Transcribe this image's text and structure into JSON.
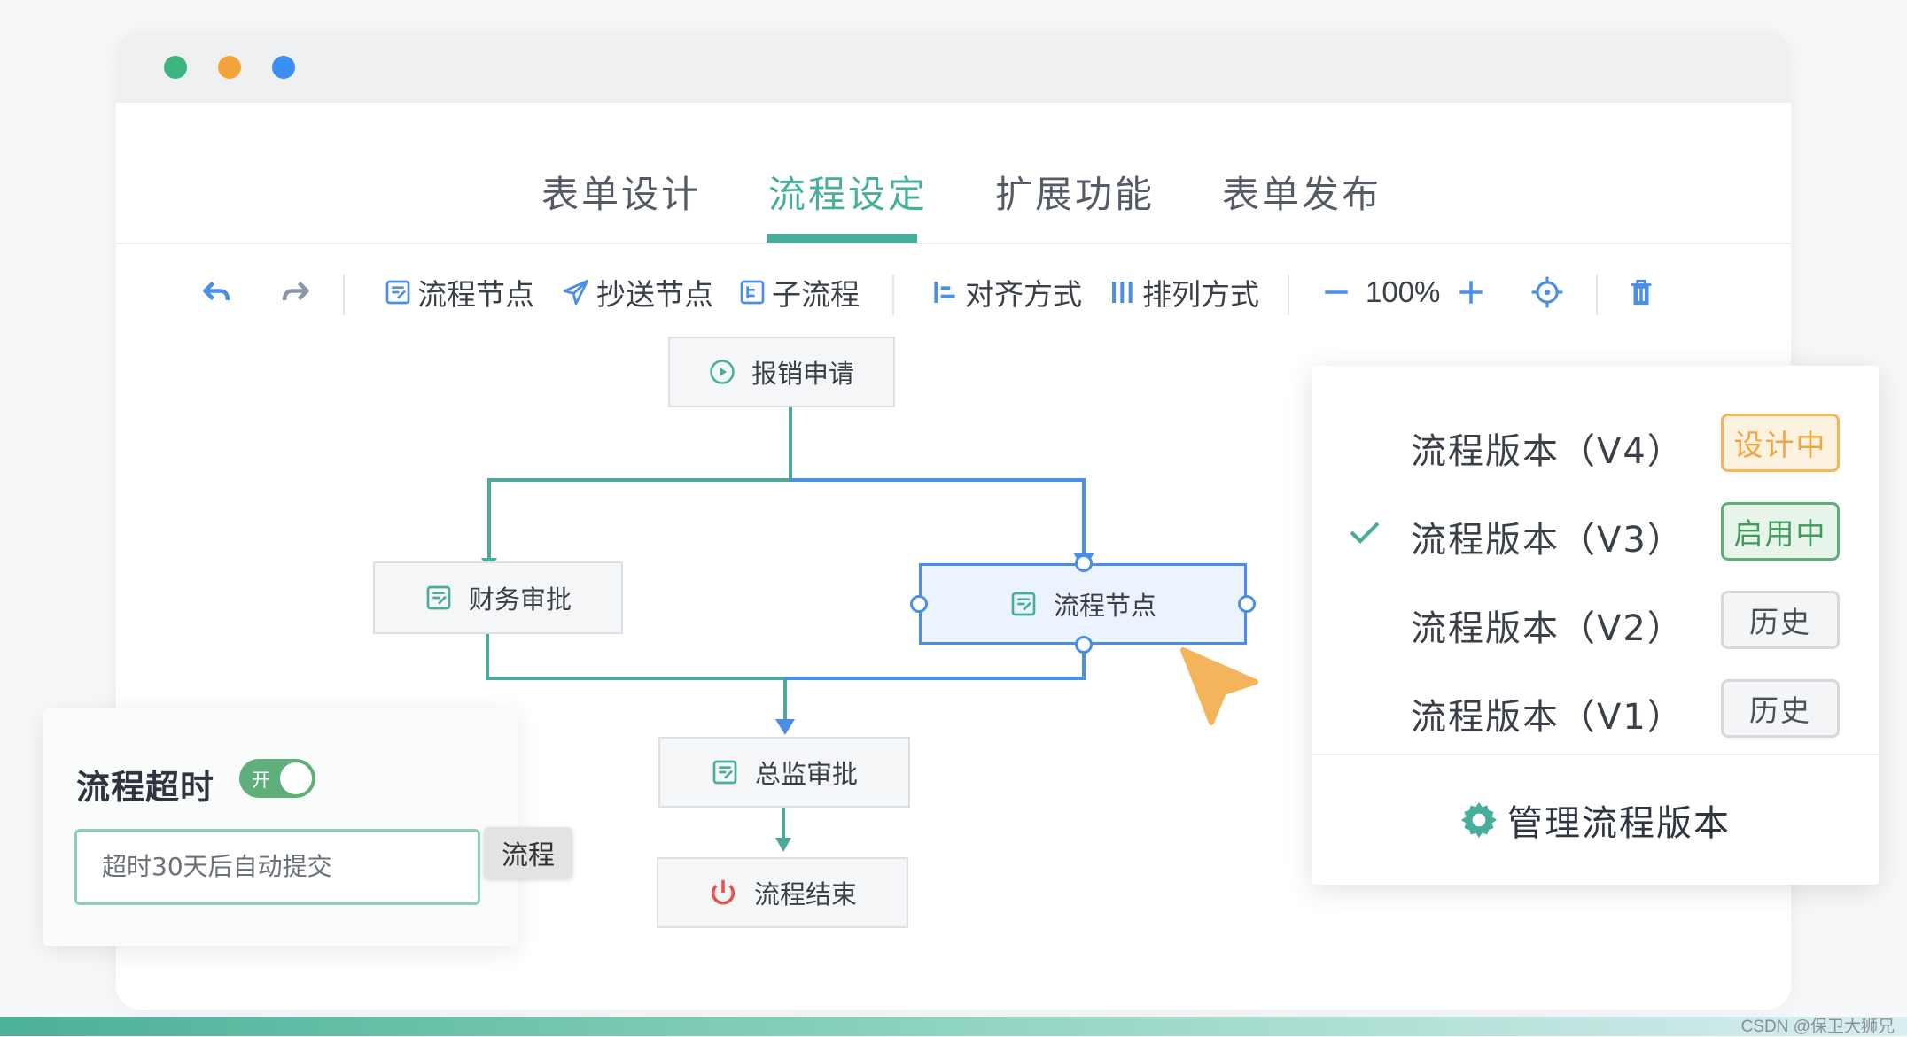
{
  "window": {
    "dots": [
      {
        "color": "#3db57f"
      },
      {
        "color": "#f4a23c"
      },
      {
        "color": "#3b8ff0"
      }
    ]
  },
  "tabs": [
    {
      "label": "表单设计",
      "active": false
    },
    {
      "label": "流程设定",
      "active": true
    },
    {
      "label": "扩展功能",
      "active": false
    },
    {
      "label": "表单发布",
      "active": false
    }
  ],
  "toolbar": {
    "undo_icon": "undo-icon",
    "redo_icon": "redo-icon",
    "flow_node": "流程节点",
    "cc_node": "抄送节点",
    "sub_flow": "子流程",
    "align": "对齐方式",
    "arrange": "排列方式",
    "zoom": "100%",
    "locate_icon": "crosshair-icon",
    "delete_icon": "trash-icon"
  },
  "flow": {
    "start": "报销申请",
    "finance": "财务审批",
    "new_node": "流程节点",
    "director": "总监审批",
    "end": "流程结束"
  },
  "versions": {
    "items": [
      {
        "label": "流程版本（V4）",
        "badge": "设计中",
        "checked": false
      },
      {
        "label": "流程版本（V3）",
        "badge": "启用中",
        "checked": true
      },
      {
        "label": "流程版本（V2）",
        "badge": "历史",
        "checked": false
      },
      {
        "label": "流程版本（V1）",
        "badge": "历史",
        "checked": false
      }
    ],
    "manage": "管理流程版本"
  },
  "timeout": {
    "title": "流程超时",
    "toggle_text": "开",
    "input_value": "超时30天后自动提交",
    "tooltip": "流程"
  },
  "colors": {
    "accent": "#48ae9c",
    "selection": "#4a8ee8",
    "design_badge": "#f3b75a",
    "active_badge": "#5eaf7a"
  },
  "watermark": "CSDN @保卫大狮兄"
}
